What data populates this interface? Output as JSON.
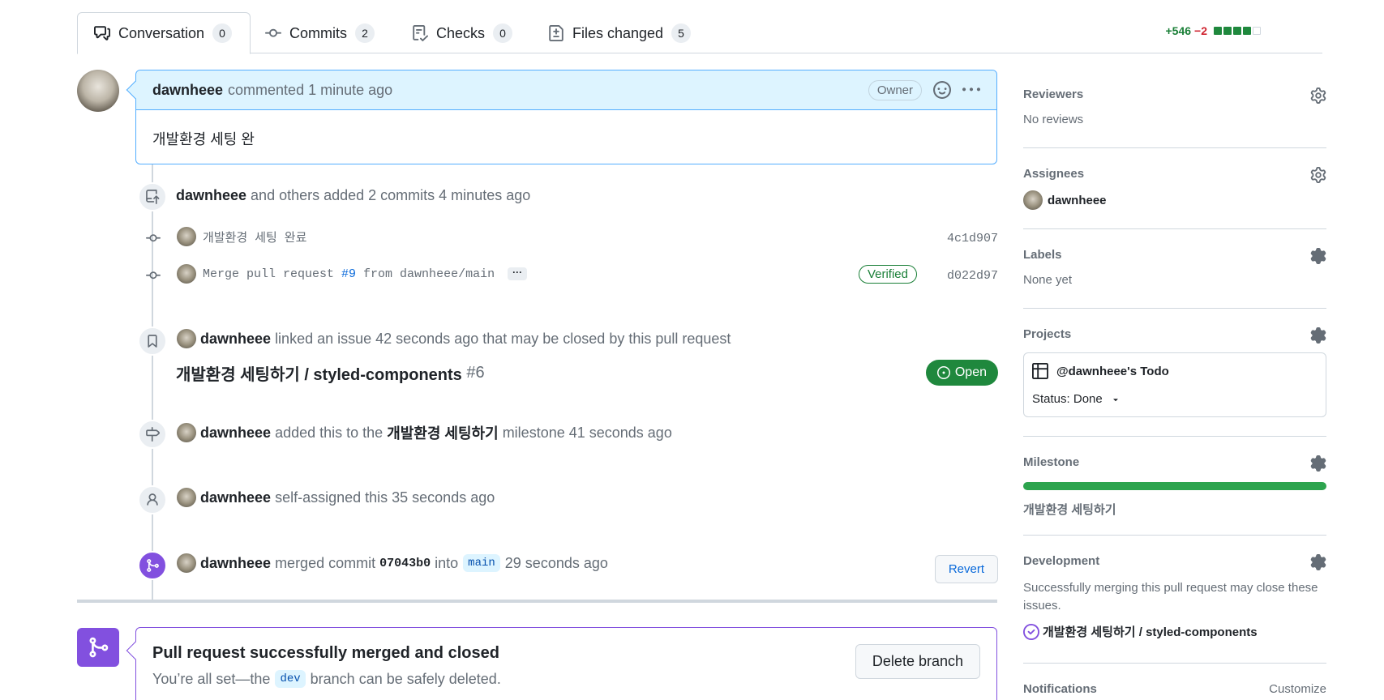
{
  "tabs": [
    {
      "label": "Conversation",
      "count": "0"
    },
    {
      "label": "Commits",
      "count": "2"
    },
    {
      "label": "Checks",
      "count": "0"
    },
    {
      "label": "Files changed",
      "count": "5"
    }
  ],
  "diffstat": {
    "additions": "+546",
    "deletions": "−2"
  },
  "comment": {
    "author": "dawnheee",
    "action": "commented 1 minute ago",
    "role": "Owner",
    "body": "개발환경 세팅 완"
  },
  "commits_event": {
    "author": "dawnheee",
    "text": "and others added 2 commits 4 minutes ago",
    "commits": [
      {
        "message": "개발환경 세팅 완료",
        "sha": "4c1d907"
      },
      {
        "message_prefix": "Merge pull request ",
        "pr_link": "#9",
        "message_suffix": " from dawnheee/main",
        "expand": "···",
        "verified": "Verified",
        "sha": "d022d97"
      }
    ]
  },
  "linked_issue": {
    "author": "dawnheee",
    "text": "linked an issue 42 seconds ago that may be closed by this pull request",
    "issue_title": "개발환경 세팅하기 / styled-components",
    "issue_number": "#6",
    "state": "Open"
  },
  "milestone_event": {
    "author": "dawnheee",
    "text_before": "added this to the",
    "milestone": "개발환경 세팅하기",
    "text_after": "milestone 41 seconds ago"
  },
  "assign_event": {
    "author": "dawnheee",
    "text": "self-assigned this 35 seconds ago"
  },
  "merge_event": {
    "author": "dawnheee",
    "text1": "merged commit",
    "commit": "07043b0",
    "text2": "into",
    "branch": "main",
    "time": "29 seconds ago",
    "revert": "Revert"
  },
  "merged_box": {
    "title": "Pull request successfully merged and closed",
    "sub_before": "You’re all set—the",
    "branch": "dev",
    "sub_after": "branch can be safely deleted.",
    "delete_label": "Delete branch"
  },
  "sidebar": {
    "reviewers": {
      "title": "Reviewers",
      "value": "No reviews"
    },
    "assignees": {
      "title": "Assignees",
      "value": "dawnheee"
    },
    "labels": {
      "title": "Labels",
      "value": "None yet"
    },
    "projects": {
      "title": "Projects",
      "project": "@dawnheee's Todo",
      "status": "Status: Done"
    },
    "milestone": {
      "title": "Milestone",
      "value": "개발환경 세팅하기",
      "progress": 1.0
    },
    "development": {
      "title": "Development",
      "description": "Successfully merging this pull request may close these issues.",
      "issue": "개발환경 세팅하기 / styled-components"
    },
    "notifications": {
      "title": "Notifications",
      "action": "Customize"
    }
  },
  "colors": {
    "accent": "#0969da",
    "merged": "#8250df",
    "open": "#1f883d",
    "add": "#1a7f37",
    "del": "#cf222e"
  }
}
